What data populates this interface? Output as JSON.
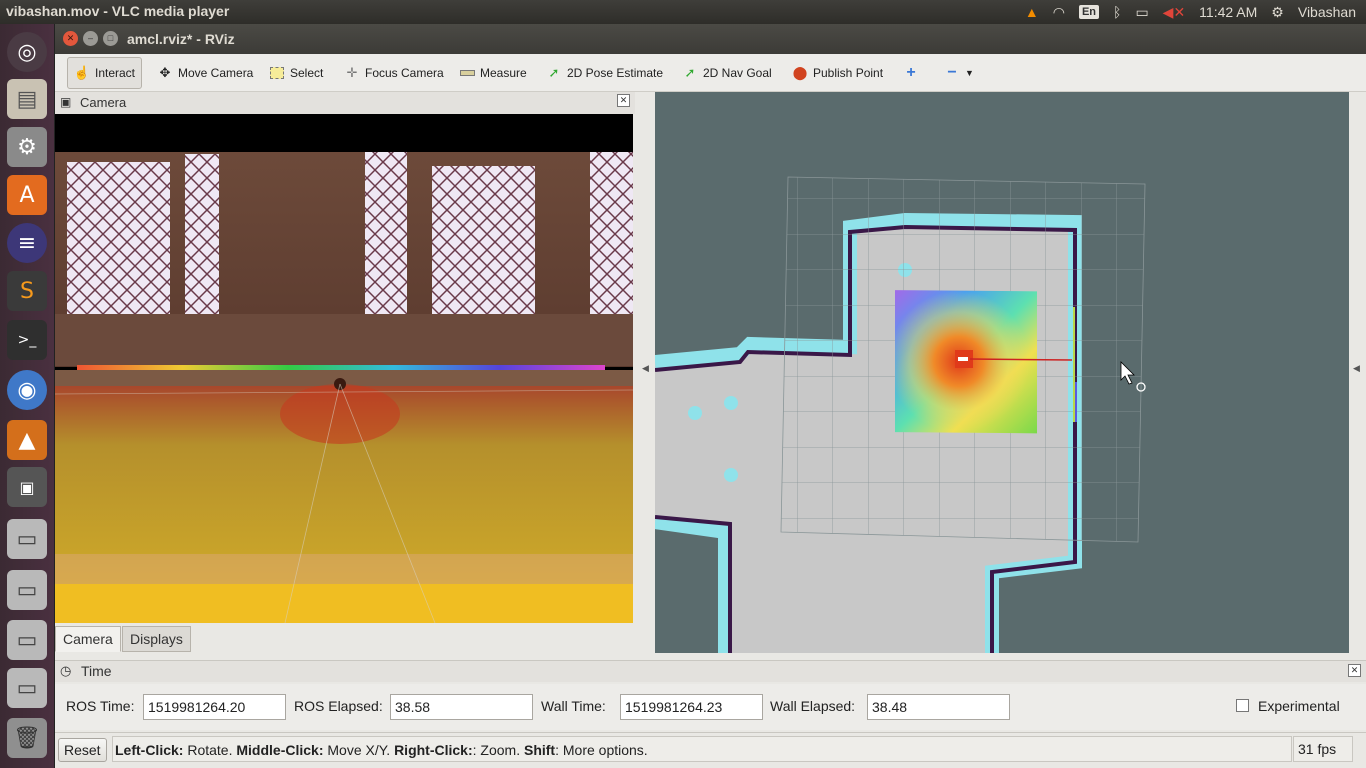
{
  "topbar": {
    "title": "vibashan.mov - VLC media player",
    "lang": "En",
    "time": "11:42 AM",
    "user": "Vibashan"
  },
  "launcher": {
    "items": [
      "ubuntu-dash",
      "files",
      "system-settings",
      "software-center",
      "eclipse",
      "sublime-text",
      "terminal",
      "chromium",
      "vlc",
      "workspaces",
      "drive-1",
      "drive-2",
      "drive-3",
      "drive-4",
      "trash"
    ]
  },
  "window": {
    "title": "amcl.rviz* - RViz"
  },
  "toolbar": {
    "interact": "Interact",
    "move_camera": "Move Camera",
    "select": "Select",
    "focus_camera": "Focus Camera",
    "measure": "Measure",
    "pose_estimate": "2D Pose Estimate",
    "nav_goal": "2D Nav Goal",
    "publish_point": "Publish Point"
  },
  "camera_panel": {
    "title": "Camera"
  },
  "tabs": {
    "camera": "Camera",
    "displays": "Displays"
  },
  "time_panel": {
    "title": "Time",
    "ros_time_label": "ROS Time:",
    "ros_time": "1519981264.20",
    "ros_elapsed_label": "ROS Elapsed:",
    "ros_elapsed": "38.58",
    "wall_time_label": "Wall Time:",
    "wall_time": "1519981264.23",
    "wall_elapsed_label": "Wall Elapsed:",
    "wall_elapsed": "38.48",
    "experimental": "Experimental"
  },
  "status": {
    "reset": "Reset",
    "hint_left_click": "Left-Click:",
    "hint_rotate": " Rotate. ",
    "hint_middle_click": "Middle-Click:",
    "hint_move": " Move X/Y. ",
    "hint_right_click": "Right-Click:",
    "hint_zoom": ": Zoom. ",
    "hint_shift": "Shift",
    "hint_more": ": More options.",
    "fps": "31 fps"
  },
  "colors": {
    "map_bg": "#5a6b6d",
    "map_free": "#c8c8c8",
    "inflation": "#8fe2ea",
    "obstacle": "#3a1848"
  }
}
